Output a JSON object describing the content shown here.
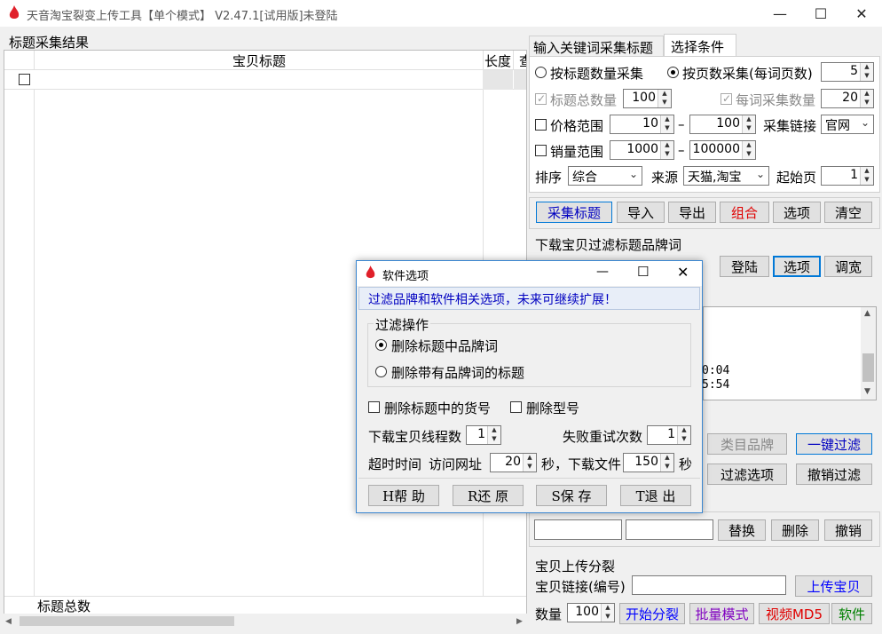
{
  "window": {
    "title": "天音淘宝裂变上传工具【单个模式】 V2.47.1[试用版]未登陆",
    "minimize": "—",
    "maximize": "☐",
    "close": "✕"
  },
  "left": {
    "section_label": "标题采集结果",
    "col_title": "宝贝标题",
    "col_length": "长度",
    "col_extra": "查",
    "footer_label": "标题总数"
  },
  "tabs": [
    "输入关键词采集标题",
    "选择条件"
  ],
  "conditions": {
    "by_count_label": "按标题数量采集",
    "by_page_label": "按页数采集(每词页数)",
    "pages_value": "5",
    "total_label": "标题总数量",
    "total_value": "100",
    "per_word_label": "每词采集数量",
    "per_word_value": "20",
    "price_label": "价格范围",
    "price_min": "10",
    "price_max": "100",
    "dash": "–",
    "link_label": "采集链接",
    "link_value": "官网",
    "sales_label": "销量范围",
    "sales_min": "1000",
    "sales_max": "100000",
    "sort_label": "排序",
    "sort_value": "综合",
    "source_label": "来源",
    "source_value": "天猫,淘宝",
    "start_page_label": "起始页",
    "start_page_value": "1"
  },
  "action_buttons": [
    "采集标题",
    "导入",
    "导出",
    "组合",
    "选项",
    "清空"
  ],
  "brand_section": {
    "label": "下载宝贝过滤标题品牌词",
    "login": "登陆",
    "options": "选项",
    "widen": "调宽",
    "log_lines": [
      "0:04",
      "5:54"
    ]
  },
  "filter_buttons": {
    "category_brand": "类目品牌",
    "one_click": "一键过滤",
    "filter_options": "过滤选项",
    "undo_filter": "撤销过滤"
  },
  "replace_row": {
    "replace": "替换",
    "delete": "删除",
    "undo": "撤销"
  },
  "upload": {
    "section_label": "宝贝上传分裂",
    "link_label": "宝贝链接(编号)",
    "upload_btn": "上传宝贝",
    "qty_label": "数量",
    "qty_value": "100",
    "start_split": "开始分裂",
    "batch_mode": "批量模式",
    "video_md5": "视频MD5",
    "software": "软件"
  },
  "dialog": {
    "title": "软件选项",
    "banner": "过滤品牌和软件相关选项，未来可继续扩展！",
    "group_label": "过滤操作",
    "radio1": "删除标题中品牌词",
    "radio2": "删除带有品牌词的标题",
    "cb_sku": "删除标题中的货号",
    "cb_model": "删除型号",
    "threads_label": "下载宝贝线程数",
    "threads_value": "1",
    "retry_label": "失败重试次数",
    "retry_value": "1",
    "timeout_label": "超时时间",
    "visit_label": "访问网址",
    "visit_value": "20",
    "sec_download_label": "秒，下载文件",
    "download_value": "150",
    "sec_label": "秒",
    "btn_help": "H帮 助",
    "btn_restore": "R还 原",
    "btn_save": "S保 存",
    "btn_exit": "T退 出",
    "close": "✕",
    "minimize": "—",
    "maximize": "☐"
  },
  "colors": {
    "accent": "#0078d7",
    "red": "#e00000",
    "purple": "#8000c0",
    "green": "#008000",
    "blue_text": "#0000ff"
  }
}
